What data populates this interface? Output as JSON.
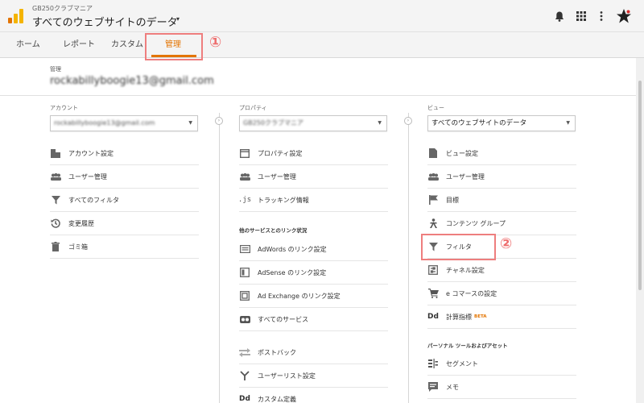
{
  "header": {
    "account_name": "GB250クラブマニア",
    "view_title": "すべてのウェブサイトのデータ",
    "caret": "▾"
  },
  "tabs": [
    {
      "label": "ホーム"
    },
    {
      "label": "レポート"
    },
    {
      "label": "カスタム"
    },
    {
      "label": "管理"
    }
  ],
  "annotations": [
    "①",
    "②"
  ],
  "admin": {
    "label": "管理",
    "email": "rockabillyboogie13@gmail.com"
  },
  "account_col": {
    "label": "アカウント",
    "selected": "rockabillyboogie13@gmail.com",
    "items": [
      {
        "label": "アカウント設定",
        "icon": "building-icon"
      },
      {
        "label": "ユーザー管理",
        "icon": "users-icon"
      },
      {
        "label": "すべてのフィルタ",
        "icon": "filter-icon"
      },
      {
        "label": "変更履歴",
        "icon": "history-icon"
      },
      {
        "label": "ゴミ箱",
        "icon": "trash-icon"
      }
    ]
  },
  "property_col": {
    "label": "プロパティ",
    "selected": "GB250クラブマニア",
    "items": [
      {
        "label": "プロパティ設定",
        "icon": "window-icon"
      },
      {
        "label": "ユーザー管理",
        "icon": "users-icon"
      },
      {
        "label": "トラッキング情報",
        "icon": "js-icon"
      }
    ],
    "section_label": "他のサービスとのリンク状況",
    "link_items": [
      {
        "label": "AdWords のリンク設定",
        "icon": "adwords-icon"
      },
      {
        "label": "AdSense のリンク設定",
        "icon": "adsense-icon"
      },
      {
        "label": "Ad Exchange のリンク設定",
        "icon": "adexchange-icon"
      },
      {
        "label": "すべてのサービス",
        "icon": "link-icon"
      }
    ],
    "bottom_items": [
      {
        "label": "ポストバック",
        "icon": "postback-icon"
      },
      {
        "label": "ユーザーリスト設定",
        "icon": "userlist-icon"
      },
      {
        "label": "カスタム定義",
        "icon": "dd-icon"
      }
    ]
  },
  "view_col": {
    "label": "ビュー",
    "selected": "すべてのウェブサイトのデータ",
    "items": [
      {
        "label": "ビュー設定",
        "icon": "document-icon"
      },
      {
        "label": "ユーザー管理",
        "icon": "users-icon"
      },
      {
        "label": "目標",
        "icon": "flag-icon"
      },
      {
        "label": "コンテンツ グループ",
        "icon": "person-icon"
      },
      {
        "label": "フィルタ",
        "icon": "filter-icon"
      },
      {
        "label": "チャネル設定",
        "icon": "channel-icon"
      },
      {
        "label": "e コマースの設定",
        "icon": "cart-icon"
      },
      {
        "label": "計算指標",
        "icon": "dd-icon",
        "badge": "BETA"
      }
    ],
    "section_label": "パーソナル ツールおよびアセット",
    "tool_items": [
      {
        "label": "セグメント",
        "icon": "segment-icon"
      },
      {
        "label": "メモ",
        "icon": "memo-icon"
      }
    ]
  },
  "colors": {
    "accent": "#e37400",
    "annotation": "#ee7e7e"
  }
}
